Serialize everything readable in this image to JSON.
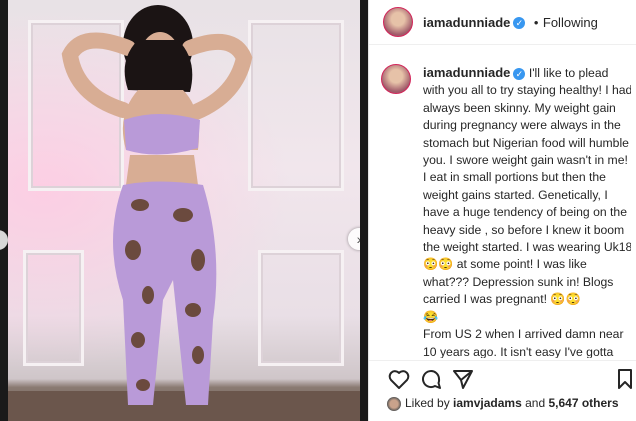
{
  "post": {
    "username": "iamadunniade",
    "verified_icon": "verified-badge-icon",
    "separator": "•",
    "follow_label": "Following",
    "caption_username": "iamadunniade",
    "caption_text": "I'll like to plead with you all to try staying healthy! I had always been skinny. My weight gain during pregnancy were always in the stomach but Nigerian food will humble you. I swore weight gain wasn't in me! I eat in small portions but then the weight gains started. Genetically, I have a huge tendency of being on the heavy side , so before I knew it boom the weight started. I was wearing Uk18 😳😳 at some point! I was like what??? Depression sunk in! Blogs carried I was pregnant! 😳😳\n😂\nFrom US 2 when I arrived damn near 10 years ago. It isn't easy I've gotta admit but it is worth it. Make that change for yourself! You can only",
    "likes_prefix": "Liked by",
    "likes_user": "iamvjadams",
    "likes_and": "and",
    "likes_count": "5,647 others",
    "next_icon": "›"
  },
  "colors": {
    "verified": "#3897f0",
    "story_ring": "#d3255a",
    "outfit": "#b99ad8"
  }
}
